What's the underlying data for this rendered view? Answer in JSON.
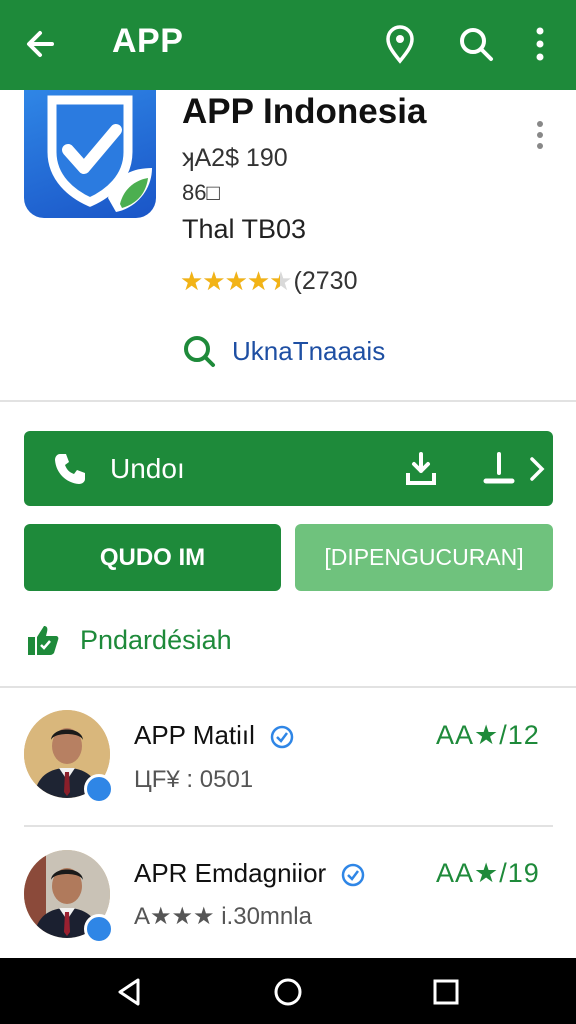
{
  "appbar": {
    "title": "APP",
    "icons": [
      "back-arrow-icon",
      "location-pin-icon",
      "search-icon",
      "more-vert-icon"
    ]
  },
  "app": {
    "name": "APP Indonesia",
    "price": "ʞA2$ 190",
    "code": "86□",
    "language": "Thal  TB03",
    "rating": 4.5,
    "rating_max": 5,
    "rating_count": "(2730",
    "developer_link": "UknaTnaaais",
    "icon": "shield-check-icon"
  },
  "actions": {
    "primary_label": "Undoı",
    "left_button": "QUDO IM",
    "right_button": "[DIPENGUCURAN]"
  },
  "favorite": {
    "label": "Pndardésiah"
  },
  "reviews": [
    {
      "name": "APP Matiıl",
      "score": "AA★/12",
      "meta": "ЦF¥ : 0501"
    },
    {
      "name": "APR Emdagniior",
      "score": "AA★/19",
      "meta": "A★★★ i.30mnla"
    }
  ],
  "colors": {
    "primary_green": "#1e8a3a",
    "light_green": "#6fc27d",
    "star": "#f2b316",
    "verified_blue": "#2f86e6"
  }
}
